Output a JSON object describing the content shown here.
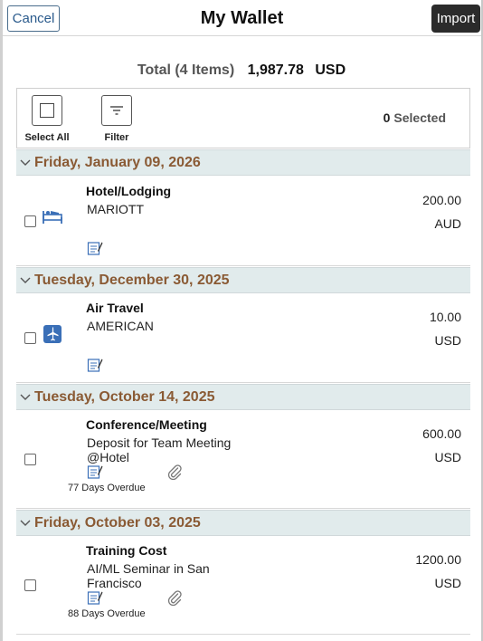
{
  "header": {
    "cancel_label": "Cancel",
    "title": "My Wallet",
    "import_label": "Import"
  },
  "summary": {
    "total_label": "Total (4 Items)",
    "total_amount": "1,987.78",
    "currency": "USD"
  },
  "toolbar": {
    "select_all_label": "Select All",
    "filter_label": "Filter",
    "selected_count": "0",
    "selected_label": "Selected"
  },
  "groups": [
    {
      "date": "Friday, January 09, 2026",
      "item": {
        "type": "Hotel/Lodging",
        "icon": "bed-icon",
        "desc": "MARIOTT",
        "amount": "200.00",
        "currency": "AUD",
        "overdue": "",
        "attachment": false
      }
    },
    {
      "date": "Tuesday, December 30, 2025",
      "item": {
        "type": "Air Travel",
        "icon": "airplane-icon",
        "desc": "AMERICAN",
        "amount": "10.00",
        "currency": "USD",
        "overdue": "",
        "attachment": false
      }
    },
    {
      "date": "Tuesday, October 14, 2025",
      "item": {
        "type": "Conference/Meeting",
        "icon": "",
        "desc": "Deposit for Team Meeting @Hotel",
        "amount": "600.00",
        "currency": "USD",
        "overdue": "77 Days Overdue",
        "attachment": true
      }
    },
    {
      "date": "Friday, October 03, 2025",
      "item": {
        "type": "Training Cost",
        "icon": "",
        "desc": "AI/ML Seminar in San Francisco",
        "amount": "1200.00",
        "currency": "USD",
        "overdue": "88 Days Overdue",
        "attachment": true
      }
    }
  ],
  "colors": {
    "group_date": "#8a5a34",
    "group_bg": "#e1ebec",
    "icon_blue": "#3a6fb7"
  }
}
